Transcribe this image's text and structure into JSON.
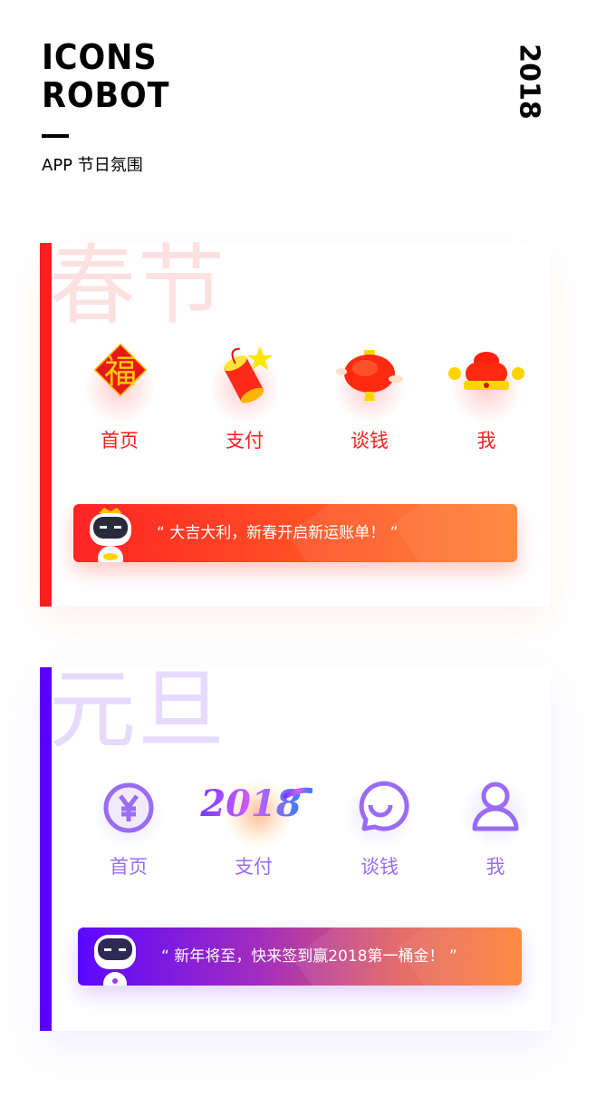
{
  "header": {
    "title_line1": "ICONS",
    "title_line2": "ROBOT",
    "subtitle": "APP 节日氛围",
    "year": "2018"
  },
  "sections": [
    {
      "id": "spring-festival",
      "title": "春节",
      "accent_color": "#ff1e1e",
      "title_color": "#fde1e1",
      "label_color": "#ff1e1e",
      "tabs": [
        {
          "label": "首页",
          "icon": "fu-diamond-icon"
        },
        {
          "label": "支付",
          "icon": "firecracker-icon"
        },
        {
          "label": "谈钱",
          "icon": "lantern-icon"
        },
        {
          "label": "我",
          "icon": "hat-icon"
        }
      ],
      "banner": {
        "text": "“ 大吉大利，新春开启新运账单！ ”",
        "gradient_start": "#ff2424",
        "gradient_end": "#ff7a26",
        "mascot": "robot-god-of-wealth-icon"
      }
    },
    {
      "id": "new-year-day",
      "title": "元旦",
      "accent_color": "#5a00ff",
      "title_color": "#e6dbff",
      "label_color": "#9b6cf4",
      "tabs": [
        {
          "label": "首页",
          "icon": "yen-coin-icon"
        },
        {
          "label": "支付",
          "icon": "2018-lettering-icon"
        },
        {
          "label": "谈钱",
          "icon": "chat-smile-icon"
        },
        {
          "label": "我",
          "icon": "user-icon"
        }
      ],
      "banner": {
        "text": "“ 新年将至，快来签到赢2018第一桶金！ ”",
        "gradient_start": "#5a08ff",
        "gradient_end": "#ff7a26",
        "mascot": "robot-icon"
      }
    }
  ]
}
